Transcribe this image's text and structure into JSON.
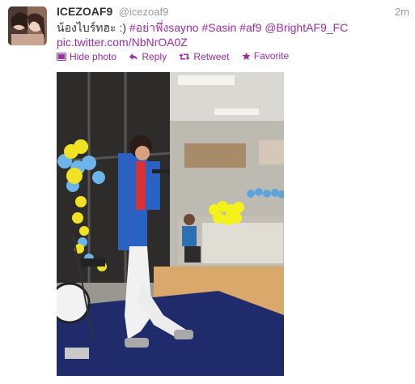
{
  "tweet": {
    "name": "ICEZOAF9",
    "handle": "@icezoaf9",
    "time": "2m",
    "text_prefix": "น้องไบร์ทฮะ :) ",
    "hashtags": [
      "#อย่าพึ่งsayno",
      "#Sasin",
      "#af9"
    ],
    "mention": "@BrightAF9_FC",
    "pic_link": "pic.twitter.com/NbNrOA0Z"
  },
  "actions": {
    "hide_photo": "Hide photo",
    "reply": "Reply",
    "retweet": "Retweet",
    "favorite": "Favorite"
  },
  "colors": {
    "link": "#9b2ba8",
    "muted": "#999999",
    "text": "#333333"
  },
  "icons": [
    "photo-icon",
    "reply-icon",
    "retweet-icon",
    "favorite-icon"
  ]
}
